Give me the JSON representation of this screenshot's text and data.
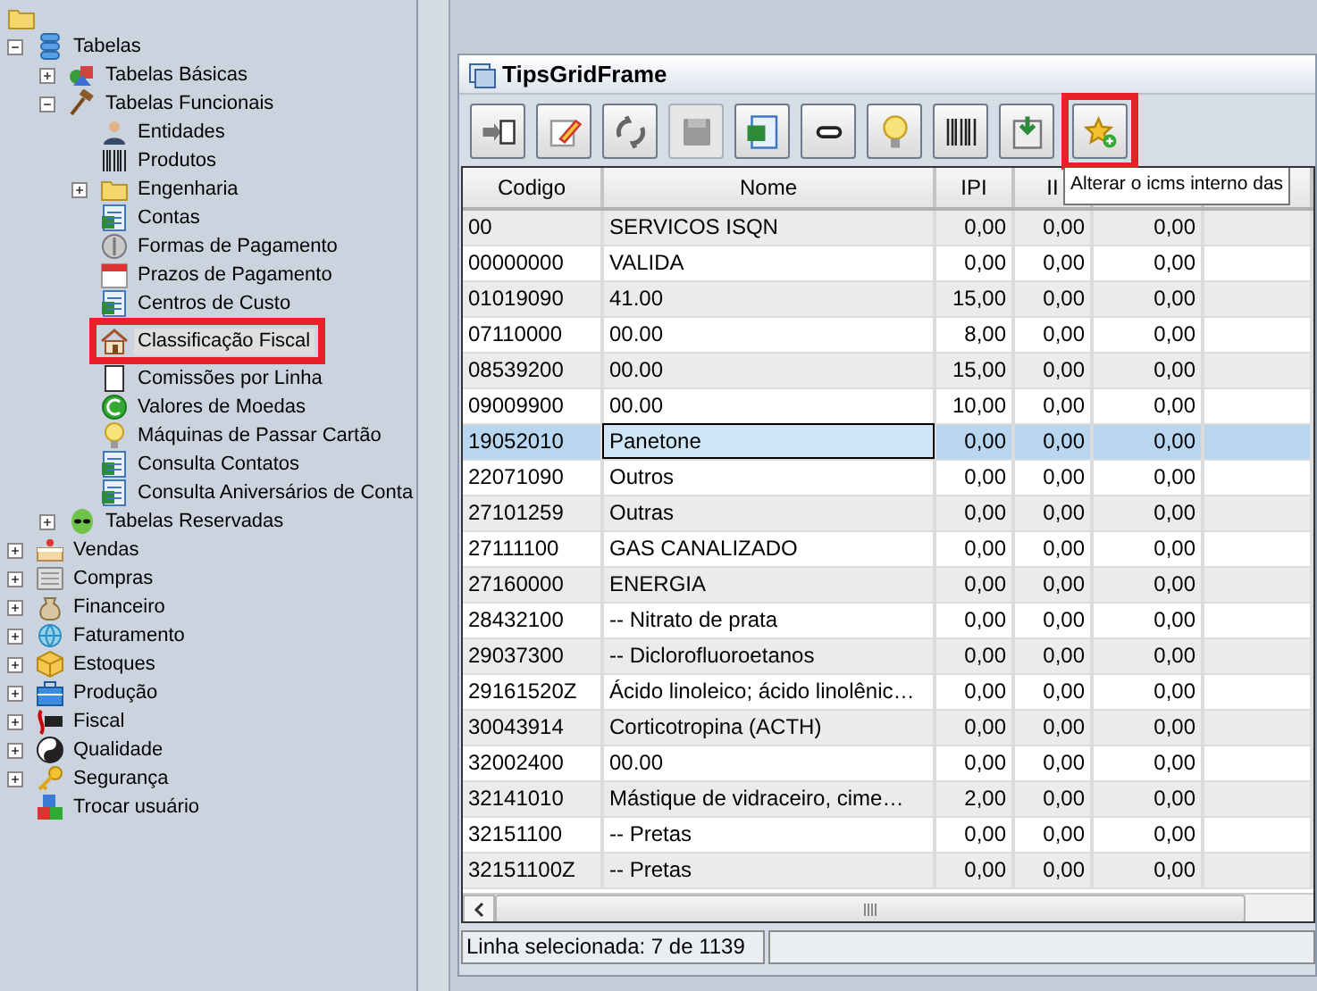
{
  "tree": [
    {
      "label": "Tabelas",
      "expanded": true,
      "selected": false,
      "highlighted": false,
      "children": [
        {
          "label": "Tabelas Básicas",
          "expanded": false,
          "selected": false,
          "highlighted": false
        },
        {
          "label": "Tabelas Funcionais",
          "expanded": true,
          "selected": false,
          "highlighted": false,
          "children": [
            {
              "label": "Entidades",
              "selected": false,
              "highlighted": false
            },
            {
              "label": "Produtos",
              "selected": false,
              "highlighted": false
            },
            {
              "label": "Engenharia",
              "expanded": false,
              "selected": false,
              "highlighted": false
            },
            {
              "label": "Contas",
              "selected": false,
              "highlighted": false
            },
            {
              "label": "Formas de Pagamento",
              "selected": false,
              "highlighted": false
            },
            {
              "label": "Prazos de Pagamento",
              "selected": false,
              "highlighted": false
            },
            {
              "label": "Centros de Custo",
              "selected": false,
              "highlighted": false
            },
            {
              "label": "Classificação Fiscal",
              "selected": true,
              "highlighted": true
            },
            {
              "label": "Comissões por Linha",
              "selected": false,
              "highlighted": false
            },
            {
              "label": "Valores de Moedas",
              "selected": false,
              "highlighted": false
            },
            {
              "label": "Máquinas de Passar Cartão",
              "selected": false,
              "highlighted": false
            },
            {
              "label": "Consulta Contatos",
              "selected": false,
              "highlighted": false
            },
            {
              "label": "Consulta Aniversários de Conta",
              "selected": false,
              "highlighted": false
            }
          ]
        },
        {
          "label": "Tabelas Reservadas",
          "expanded": false,
          "selected": false,
          "highlighted": false
        }
      ]
    },
    {
      "label": "Vendas",
      "expanded": false,
      "selected": false,
      "highlighted": false
    },
    {
      "label": "Compras",
      "expanded": false,
      "selected": false,
      "highlighted": false
    },
    {
      "label": "Financeiro",
      "expanded": false,
      "selected": false,
      "highlighted": false
    },
    {
      "label": "Faturamento",
      "expanded": false,
      "selected": false,
      "highlighted": false
    },
    {
      "label": "Estoques",
      "expanded": false,
      "selected": false,
      "highlighted": false
    },
    {
      "label": "Produção",
      "expanded": false,
      "selected": false,
      "highlighted": false
    },
    {
      "label": "Fiscal",
      "expanded": false,
      "selected": false,
      "highlighted": false
    },
    {
      "label": "Qualidade",
      "expanded": false,
      "selected": false,
      "highlighted": false
    },
    {
      "label": "Segurança",
      "expanded": false,
      "selected": false,
      "highlighted": false
    },
    {
      "label": "Trocar usuário",
      "selected": false,
      "highlighted": false
    }
  ],
  "window": {
    "title": "TipsGridFrame",
    "toolbar": [
      {
        "disabled": false,
        "highlighted": false
      },
      {
        "disabled": false,
        "highlighted": false
      },
      {
        "disabled": false,
        "highlighted": false
      },
      {
        "disabled": true,
        "highlighted": false
      },
      {
        "disabled": false,
        "highlighted": false
      },
      {
        "disabled": false,
        "highlighted": false
      },
      {
        "disabled": false,
        "highlighted": false
      },
      {
        "disabled": false,
        "highlighted": false
      },
      {
        "disabled": false,
        "highlighted": false
      },
      {
        "disabled": false,
        "highlighted": true
      }
    ],
    "tooltip": "Alterar o icms interno das",
    "table": {
      "columns": [
        "Codigo",
        "Nome",
        "IPI",
        "II"
      ],
      "rows": [
        {
          "cells": [
            "00",
            "SERVICOS ISQN",
            "0,00",
            "0,00",
            "0,00"
          ],
          "selected": false
        },
        {
          "cells": [
            "00000000",
            "VALIDA",
            "0,00",
            "0,00",
            "0,00"
          ],
          "selected": false
        },
        {
          "cells": [
            "01019090",
            "41.00",
            "15,00",
            "0,00",
            "0,00"
          ],
          "selected": false
        },
        {
          "cells": [
            "07110000",
            "00.00",
            "8,00",
            "0,00",
            "0,00"
          ],
          "selected": false
        },
        {
          "cells": [
            "08539200",
            "00.00",
            "15,00",
            "0,00",
            "0,00"
          ],
          "selected": false
        },
        {
          "cells": [
            "09009900",
            "00.00",
            "10,00",
            "0,00",
            "0,00"
          ],
          "selected": false
        },
        {
          "cells": [
            "19052010",
            "Panetone",
            "0,00",
            "0,00",
            "0,00"
          ],
          "selected": true
        },
        {
          "cells": [
            "22071090",
            "Outros",
            "0,00",
            "0,00",
            "0,00"
          ],
          "selected": false
        },
        {
          "cells": [
            "27101259",
            "Outras",
            "0,00",
            "0,00",
            "0,00"
          ],
          "selected": false
        },
        {
          "cells": [
            "27111100",
            "GAS CANALIZADO",
            "0,00",
            "0,00",
            "0,00"
          ],
          "selected": false
        },
        {
          "cells": [
            "27160000",
            "ENERGIA",
            "0,00",
            "0,00",
            "0,00"
          ],
          "selected": false
        },
        {
          "cells": [
            "28432100",
            "-- Nitrato de prata",
            "0,00",
            "0,00",
            "0,00"
          ],
          "selected": false
        },
        {
          "cells": [
            "29037300",
            "-- Diclorofluoroetanos",
            "0,00",
            "0,00",
            "0,00"
          ],
          "selected": false
        },
        {
          "cells": [
            "29161520Z",
            "Ácido linoleico; ácido linolênic…",
            "0,00",
            "0,00",
            "0,00"
          ],
          "selected": false
        },
        {
          "cells": [
            "30043914",
            "Corticotropina (ACTH)",
            "0,00",
            "0,00",
            "0,00"
          ],
          "selected": false
        },
        {
          "cells": [
            "32002400",
            "00.00",
            "0,00",
            "0,00",
            "0,00"
          ],
          "selected": false
        },
        {
          "cells": [
            "32141010",
            "Mástique de vidraceiro, cime…",
            "2,00",
            "0,00",
            "0,00"
          ],
          "selected": false
        },
        {
          "cells": [
            "32151100",
            "-- Pretas",
            "0,00",
            "0,00",
            "0,00"
          ],
          "selected": false
        },
        {
          "cells": [
            "32151100Z",
            "-- Pretas",
            "0,00",
            "0,00",
            "0,00"
          ],
          "selected": false
        }
      ]
    },
    "status_bar": "Linha selecionada: 7 de 1139"
  }
}
